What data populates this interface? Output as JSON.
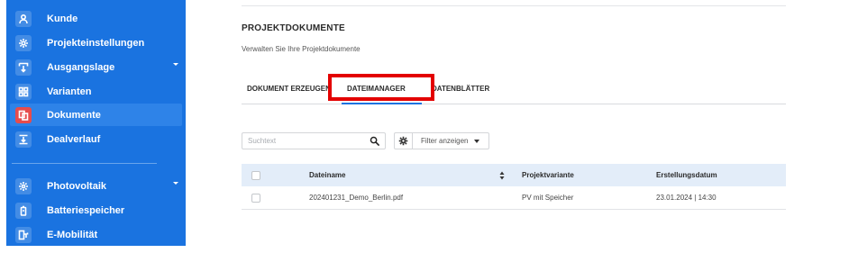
{
  "sidebar": {
    "items": [
      {
        "label": "Kunde",
        "icon": "user-icon"
      },
      {
        "label": "Projekteinstellungen",
        "icon": "gear-icon"
      },
      {
        "label": "Ausgangslage",
        "icon": "download-box-icon"
      },
      {
        "label": "Varianten",
        "icon": "grid-icon"
      },
      {
        "label": "Dokumente",
        "icon": "documents-icon",
        "active": true
      },
      {
        "label": "Dealverlauf",
        "icon": "download-tray-icon"
      },
      {
        "label": "Photovoltaik",
        "icon": "sun-icon"
      },
      {
        "label": "Batteriespeicher",
        "icon": "battery-icon"
      },
      {
        "label": "E-Mobilität",
        "icon": "ev-charger-icon"
      }
    ],
    "accent_color": "#1a73e0",
    "active_icon_color": "#e74c4c"
  },
  "page": {
    "title": "PROJEKTDOKUMENTE",
    "subtitle": "Verwalten Sie Ihre Projektdokumente"
  },
  "tabs": [
    {
      "label": "DOKUMENT ERZEUGEN"
    },
    {
      "label": "DATEIMANAGER",
      "active": true
    },
    {
      "label": "DATENBLÄTTER"
    }
  ],
  "highlight_color": "#e30000",
  "toolbar": {
    "search_placeholder": "Suchtext",
    "filter_label": "Filter anzeigen"
  },
  "table": {
    "columns": [
      "Dateiname",
      "Projektvariante",
      "Erstellungsdatum"
    ],
    "rows": [
      {
        "filename": "202401231_Demo_Berlin.pdf",
        "variant": "PV mit Speicher",
        "date": "23.01.2024 | 14:30"
      }
    ]
  }
}
